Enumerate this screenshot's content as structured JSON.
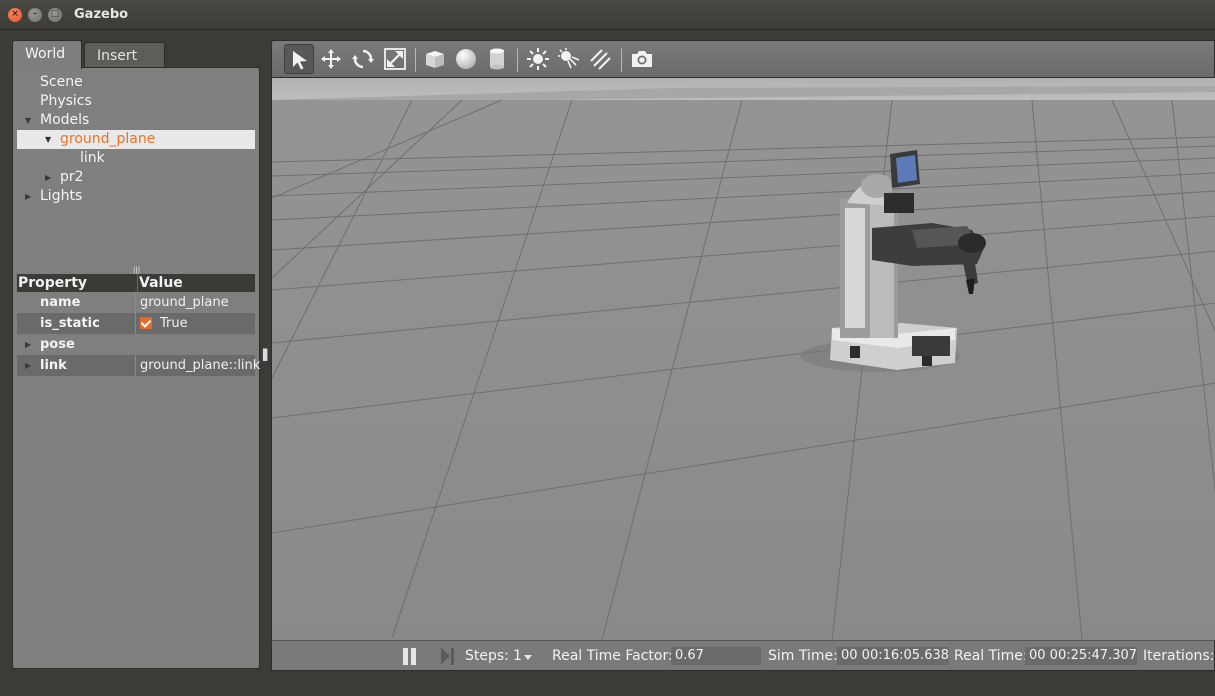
{
  "window": {
    "title": "Gazebo",
    "close_glyph": "×",
    "min_glyph": "–",
    "max_glyph": "□"
  },
  "left_panel": {
    "tabs": [
      {
        "label": "World",
        "active": true
      },
      {
        "label": "Insert",
        "active": false
      }
    ],
    "tree": [
      {
        "label": "Scene",
        "level": 0,
        "expander": "none"
      },
      {
        "label": "Physics",
        "level": 0,
        "expander": "none"
      },
      {
        "label": "Models",
        "level": 0,
        "expander": "expanded"
      },
      {
        "label": "ground_plane",
        "level": 1,
        "expander": "expanded",
        "selected": true
      },
      {
        "label": "link",
        "level": 2,
        "expander": "none"
      },
      {
        "label": "pr2",
        "level": 1,
        "expander": "collapsed"
      },
      {
        "label": "Lights",
        "level": 0,
        "expander": "collapsed"
      }
    ],
    "properties": {
      "header": {
        "property": "Property",
        "value": "Value"
      },
      "rows": [
        {
          "key": "name",
          "value": "ground_plane"
        },
        {
          "key": "is_static",
          "value": "True",
          "checked": true
        },
        {
          "key": "pose",
          "value": ""
        },
        {
          "key": "link",
          "value": "ground_plane::link"
        }
      ]
    }
  },
  "toolbar": {
    "tools": [
      {
        "icon": "select-arrow-icon",
        "active": true
      },
      {
        "icon": "translate-icon"
      },
      {
        "icon": "rotate-icon"
      },
      {
        "icon": "scale-icon"
      },
      {
        "icon": "box-icon"
      },
      {
        "icon": "sphere-icon"
      },
      {
        "icon": "cylinder-icon"
      },
      {
        "icon": "point-light-icon"
      },
      {
        "icon": "spot-light-icon"
      },
      {
        "icon": "directional-light-icon"
      },
      {
        "icon": "camera-icon"
      }
    ]
  },
  "bottom_bar": {
    "steps_label": "Steps:",
    "steps_value": "1",
    "rtf_label": "Real Time Factor:",
    "rtf_value": "0.67",
    "sim_time_label": "Sim Time:",
    "sim_time_value": "00 00:16:05.638",
    "real_time_label": "Real Time:",
    "real_time_value": "00 00:25:47.307",
    "iterations_label": "Iterations:"
  },
  "colors": {
    "selected_text": "#e77426",
    "checkbox": "#e96b2b",
    "ground": "#8e8e8e",
    "sky": "#b5b5b5"
  }
}
